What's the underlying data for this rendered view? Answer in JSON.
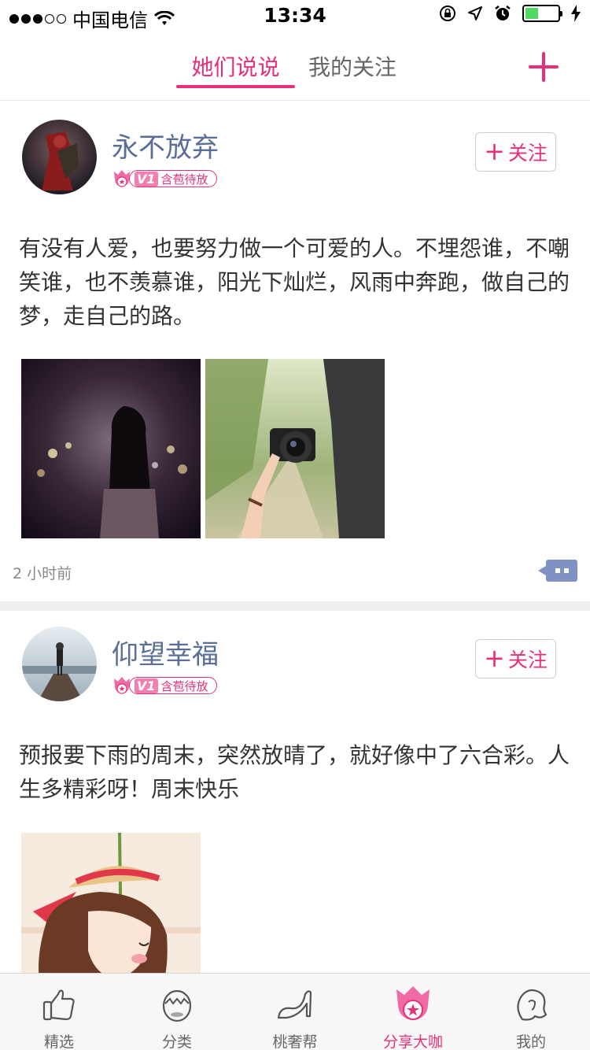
{
  "status_bar": {
    "carrier": "中国电信",
    "time": "13:34"
  },
  "header": {
    "tabs": [
      {
        "label": "她们说说",
        "active": true
      },
      {
        "label": "我的关注",
        "active": false
      }
    ]
  },
  "posts": [
    {
      "username": "永不放弃",
      "level_badge": "V1",
      "level_title": "含苞待放",
      "follow_label": "关注",
      "text": "有没有人爱，也要努力做一个可爱的人。不埋怨谁，不嘲笑谁，也不羡慕谁，阳光下灿烂，风雨中奔跑，做自己的梦，走自己的路。",
      "time": "2 小时前"
    },
    {
      "username": "仰望幸福",
      "level_badge": "V1",
      "level_title": "含苞待放",
      "follow_label": "关注",
      "text": "预报要下雨的周末，突然放晴了，就好像中了六合彩。人生多精彩呀！周末快乐"
    }
  ],
  "tabbar": {
    "items": [
      {
        "label": "精选",
        "icon": "thumbs-up-icon",
        "active": false
      },
      {
        "label": "分类",
        "icon": "egg-category-icon",
        "active": false
      },
      {
        "label": "桃奢帮",
        "icon": "high-heel-icon",
        "active": false
      },
      {
        "label": "分享大咖",
        "icon": "star-shield-icon",
        "active": true
      },
      {
        "label": "我的",
        "icon": "girl-profile-icon",
        "active": false
      }
    ]
  },
  "colors": {
    "accent": "#e8307a",
    "username": "#5a6e98",
    "comment": "#7e93c4"
  }
}
